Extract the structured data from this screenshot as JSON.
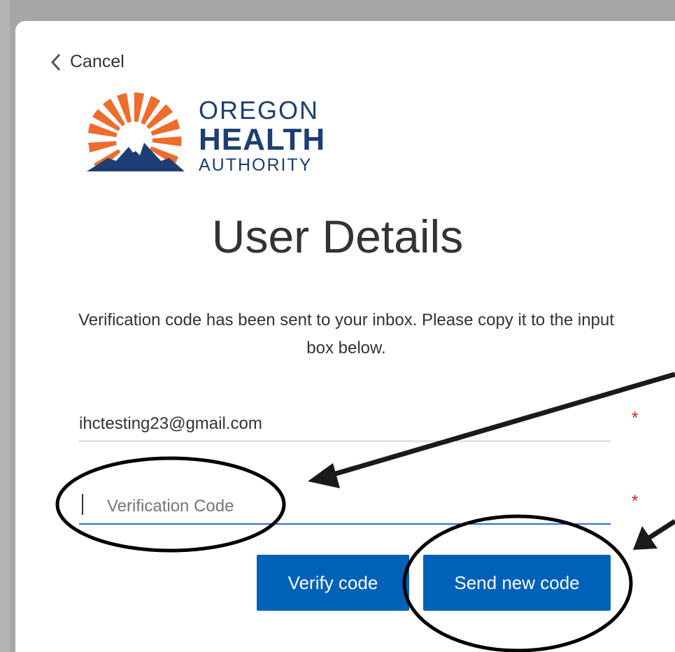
{
  "nav": {
    "cancel_label": "Cancel"
  },
  "logo": {
    "line1": "OREGON",
    "line2": "HEALTH",
    "line3": "AUTHORITY"
  },
  "page": {
    "title": "User Details",
    "intro": "Verification code has been sent to your inbox. Please copy it to the input box below."
  },
  "form": {
    "email_value": "ihctesting23@gmail.com",
    "code_placeholder": "Verification Code",
    "required_marker": "*"
  },
  "buttons": {
    "verify_label": "Verify code",
    "send_label": "Send new code"
  },
  "colors": {
    "primary": "#0061b8",
    "brand_navy": "#1c3e73",
    "sun_orange": "#ee6c2c",
    "required": "#e21b1b",
    "focus": "#2c6dd5"
  }
}
